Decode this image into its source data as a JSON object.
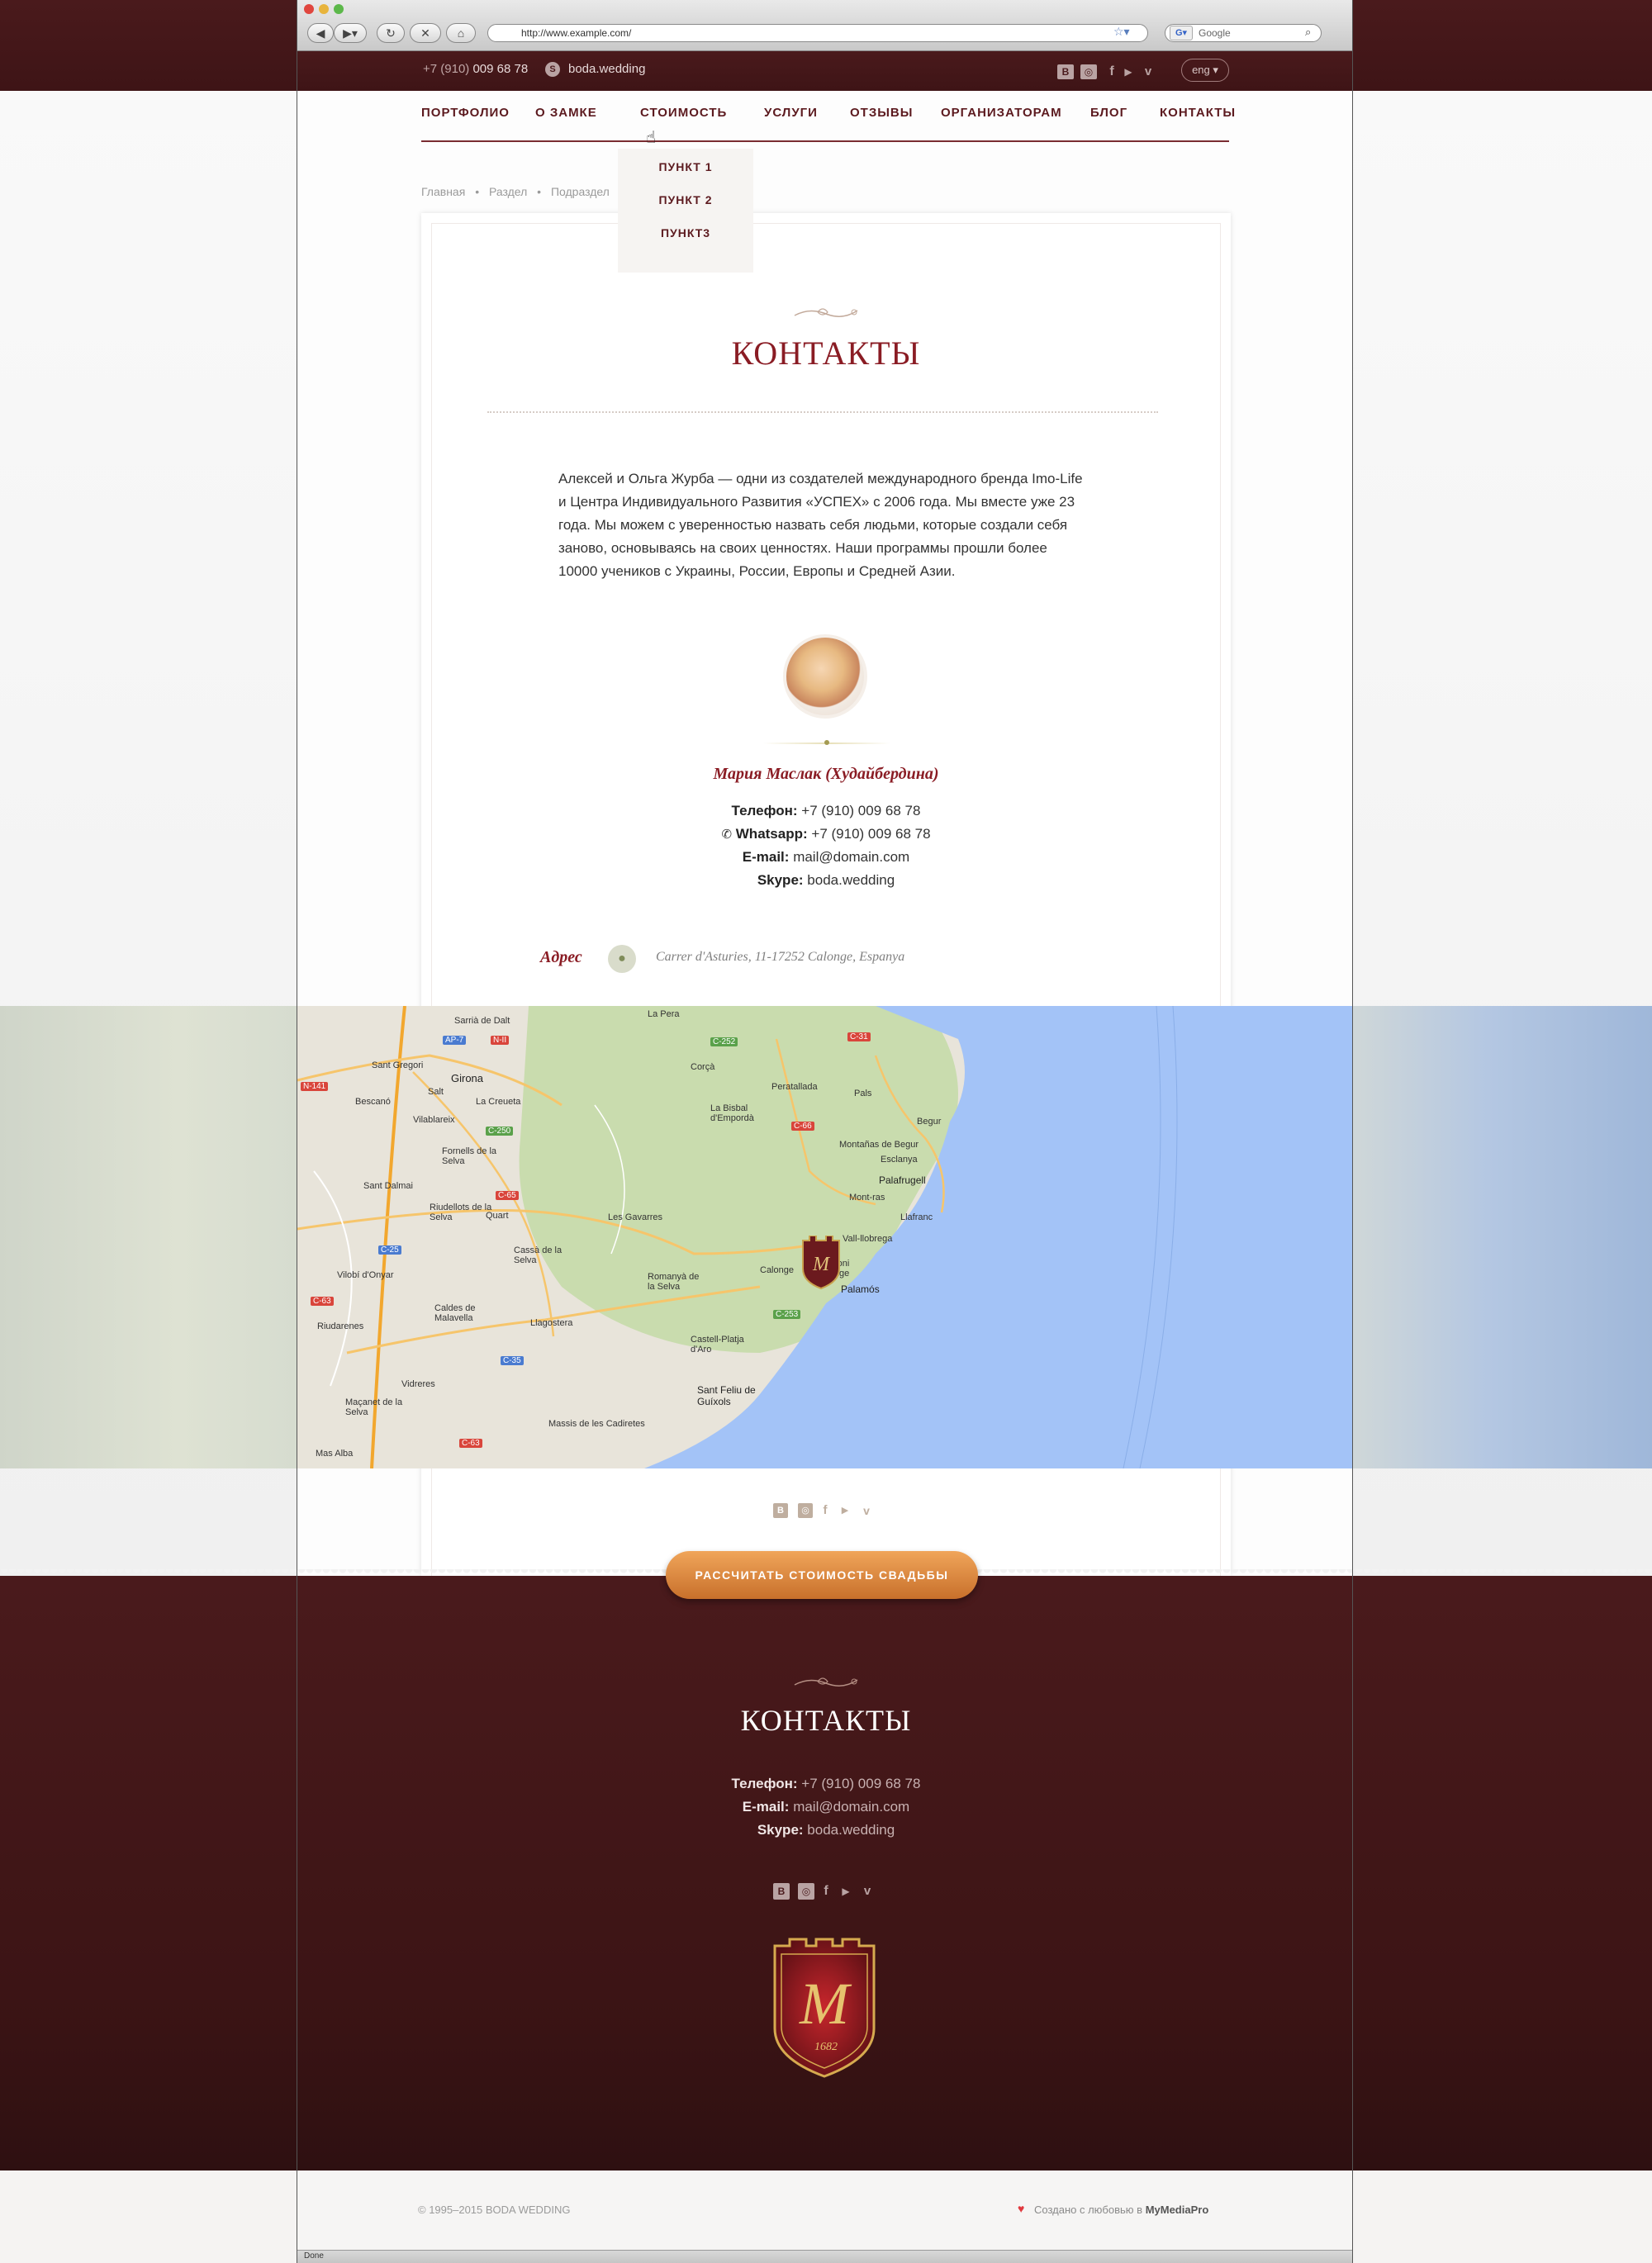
{
  "browser": {
    "url": "http://www.example.com/",
    "search_placeholder": "Google",
    "status": "Done"
  },
  "topbar": {
    "phone_prefix": "+7 (910)",
    "phone_number": "009 68 78",
    "skype": "boda.wedding",
    "social": [
      "В",
      "◎",
      "f",
      "▶",
      "v"
    ],
    "lang": "eng ▾"
  },
  "nav": {
    "items": [
      "ПОРТФОЛИО",
      "О ЗАМКЕ",
      "СТОИМОСТЬ",
      "УСЛУГИ",
      "ОТЗЫВЫ",
      "ОРГАНИЗАТОРАМ",
      "БЛОГ",
      "КОНТАКТЫ"
    ],
    "dropdown": [
      "ПУНКТ 1",
      "ПУНКТ 2",
      "ПУНКТ3"
    ]
  },
  "breadcrumbs": [
    "Главная",
    "Раздел",
    "Подраздел"
  ],
  "content": {
    "title": "КОНТАКТЫ",
    "about": "Алексей и Ольга Журба — одни из создателей международного бренда Imo-Life и Центра Индивидуального Развития «УСПЕХ» с 2006 года. Мы вместе уже 23 года. Мы можем с уверенностью назвать себя людьми, которые создали себя заново, основываясь на своих ценностях. Наши программы прошли более 10000 учеников с Украины, России, Европы и Средней Азии.",
    "person": "Мария Маслак (Худайбердина)",
    "phone_label": "Телефон:",
    "phone": "+7 (910) 009 68 78",
    "whatsapp_label": "Whatsapp:",
    "whatsapp": "+7 (910) 009 68 78",
    "email_label": "E-mail:",
    "email": "mail@domain.com",
    "skype_label": "Skype:",
    "skype": "boda.wedding",
    "address_label": "Адрес",
    "address": "Carrer d'Asturies, 11-17252 Calonge, Espanya"
  },
  "map": {
    "towns": [
      "Girona",
      "Sant Gregori",
      "Bescanó",
      "Vilablareix",
      "Salt",
      "La Creueta",
      "Fornells de la Selva",
      "Sant Dalmai",
      "Quart",
      "Riudellots de la Selva",
      "Cassà de la Selva",
      "Vilobí d'Onyar",
      "Riudarenes",
      "Caldes de Malavella",
      "Llagostera",
      "Vidreres",
      "Maçanet de la Selva",
      "Mas Alba",
      "Les Gavarres",
      "Romanyà de la Selva",
      "Massis de les Cadiretes",
      "Sant Feliu de Guíxols",
      "Castell-Platja d'Aro",
      "Calonge",
      "Palamós",
      "Palafrugell",
      "Mont-ras",
      "Llafranc",
      "Begur",
      "Esclanya",
      "Montañas de Begur",
      "La Bisbal d'Empordà",
      "Corçà",
      "Peratallada",
      "Pals",
      "La Pera",
      "Sarrià de Dalt",
      "Vall-llobrega",
      "Sant Antoni de Calonge"
    ],
    "roads": [
      "AP-7",
      "N-II",
      "N-141",
      "C-250",
      "C-65",
      "C-25",
      "C-63",
      "C-35",
      "C-252",
      "C-66",
      "C-31",
      "C-253",
      "C-63"
    ]
  },
  "social_under_map": [
    "В",
    "◎",
    "f",
    "▶",
    "v"
  ],
  "cta": "РАССЧИТАТЬ СТОИМОСТЬ СВАДЬБЫ",
  "footer": {
    "title": "КОНТАКТЫ",
    "phone_label": "Телефон:",
    "phone": "+7 (910) 009 68 78",
    "email_label": "E-mail:",
    "email": "mail@domain.com",
    "skype_label": "Skype:",
    "skype": "boda.wedding",
    "social": [
      "В",
      "◎",
      "f",
      "▶",
      "v"
    ],
    "crest_year": "1682",
    "crest_letter": "M"
  },
  "bottom": {
    "copyright": "© 1995–2015 BODA WEDDING",
    "made_prefix": "Создано с любовью в",
    "made_brand": "MyMediaPro"
  },
  "colors": {
    "maroon": "#4a1a1c",
    "accent": "#8a1c24",
    "cta": "#e08a3c",
    "sea": "#a3c3f7",
    "land": "#e9e5dc"
  }
}
